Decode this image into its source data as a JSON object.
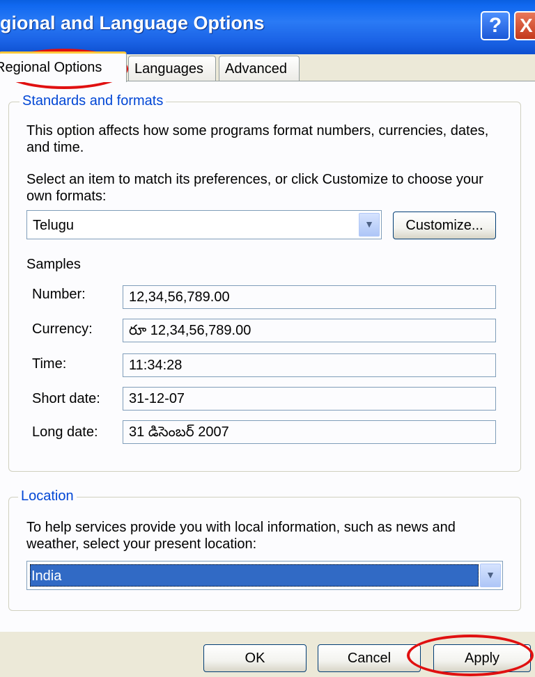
{
  "window": {
    "title": "gional and Language Options",
    "help_glyph": "?",
    "close_glyph": "X"
  },
  "tabs": [
    {
      "label": "Regional Options",
      "active": true
    },
    {
      "label": "Languages",
      "active": false
    },
    {
      "label": "Advanced",
      "active": false
    }
  ],
  "standards": {
    "group_label": "Standards and formats",
    "description": "This option affects how some programs format numbers, currencies, dates, and time.",
    "select_prompt": "Select an item to match its preferences, or click Customize to choose your own formats:",
    "format_value": "Telugu",
    "customize_label": "Customize...",
    "samples_label": "Samples",
    "samples": [
      {
        "label": "Number:",
        "value": "12,34,56,789.00"
      },
      {
        "label": "Currency:",
        "value": "రూ 12,34,56,789.00"
      },
      {
        "label": "Time:",
        "value": "11:34:28"
      },
      {
        "label": "Short date:",
        "value": "31-12-07"
      },
      {
        "label": "Long date:",
        "value": "31 డిసెంబర్ 2007"
      }
    ]
  },
  "location": {
    "group_label": "Location",
    "description": "To help services provide you with local information, such as news and weather, select your present location:",
    "value": "India"
  },
  "buttons": {
    "ok": "OK",
    "cancel": "Cancel",
    "apply": "Apply"
  },
  "colors": {
    "title_bar": "#1b63e6",
    "group_label": "#0046d5",
    "selection": "#316ac5",
    "highlight_ellipse": "#e01010"
  },
  "icons": {
    "combo_arrow": "chevron-down-icon"
  }
}
